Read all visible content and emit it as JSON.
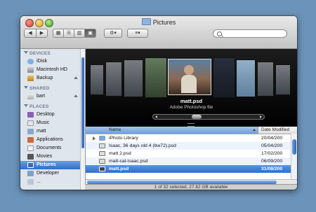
{
  "window": {
    "title": "Pictures"
  },
  "toolbar": {
    "back_icon": "back-arrow-icon",
    "forward_icon": "forward-arrow-icon",
    "views": [
      "icon-view",
      "list-view",
      "column-view",
      "coverflow-view"
    ],
    "active_view": "coverflow-view",
    "action_icon": "gear-icon",
    "arrange_icon": "arrange-icon",
    "search_placeholder": ""
  },
  "sidebar": {
    "sections": [
      {
        "heading": "DEVICES",
        "items": [
          "iDisk",
          "Macintosh HD",
          "Backup"
        ]
      },
      {
        "heading": "SHARED",
        "items": [
          "bart"
        ]
      },
      {
        "heading": "PLACES",
        "items": [
          "Desktop",
          "Music",
          "matt",
          "Applications",
          "Documents",
          "Movies",
          "Pictures",
          "Developer",
          "..."
        ]
      }
    ],
    "selected": "Pictures"
  },
  "coverflow": {
    "file_name": "matt.psd",
    "file_kind": "Adobe Photoshop file"
  },
  "list": {
    "columns": [
      "Name",
      "Date Modified"
    ],
    "rows": [
      {
        "name": "iPhoto Library",
        "date": "20/04/200",
        "kind": "folder"
      },
      {
        "name": "Isaac, 36 days old 4 (bw72).psd",
        "date": "05/04/200",
        "kind": "psd"
      },
      {
        "name": "matt 2.psd",
        "date": "17/02/200",
        "kind": "psd"
      },
      {
        "name": "matt-cat-isaac.psd",
        "date": "06/09/200",
        "kind": "psd"
      },
      {
        "name": "matt.psd",
        "date": "31/08/200",
        "kind": "psd"
      }
    ],
    "selected_row": "matt.psd"
  },
  "status": {
    "text": "1 of 32 selected, 27.82 GB available"
  },
  "colors": {
    "selection": "#3a78d0",
    "desktop": "#6c93b9"
  }
}
